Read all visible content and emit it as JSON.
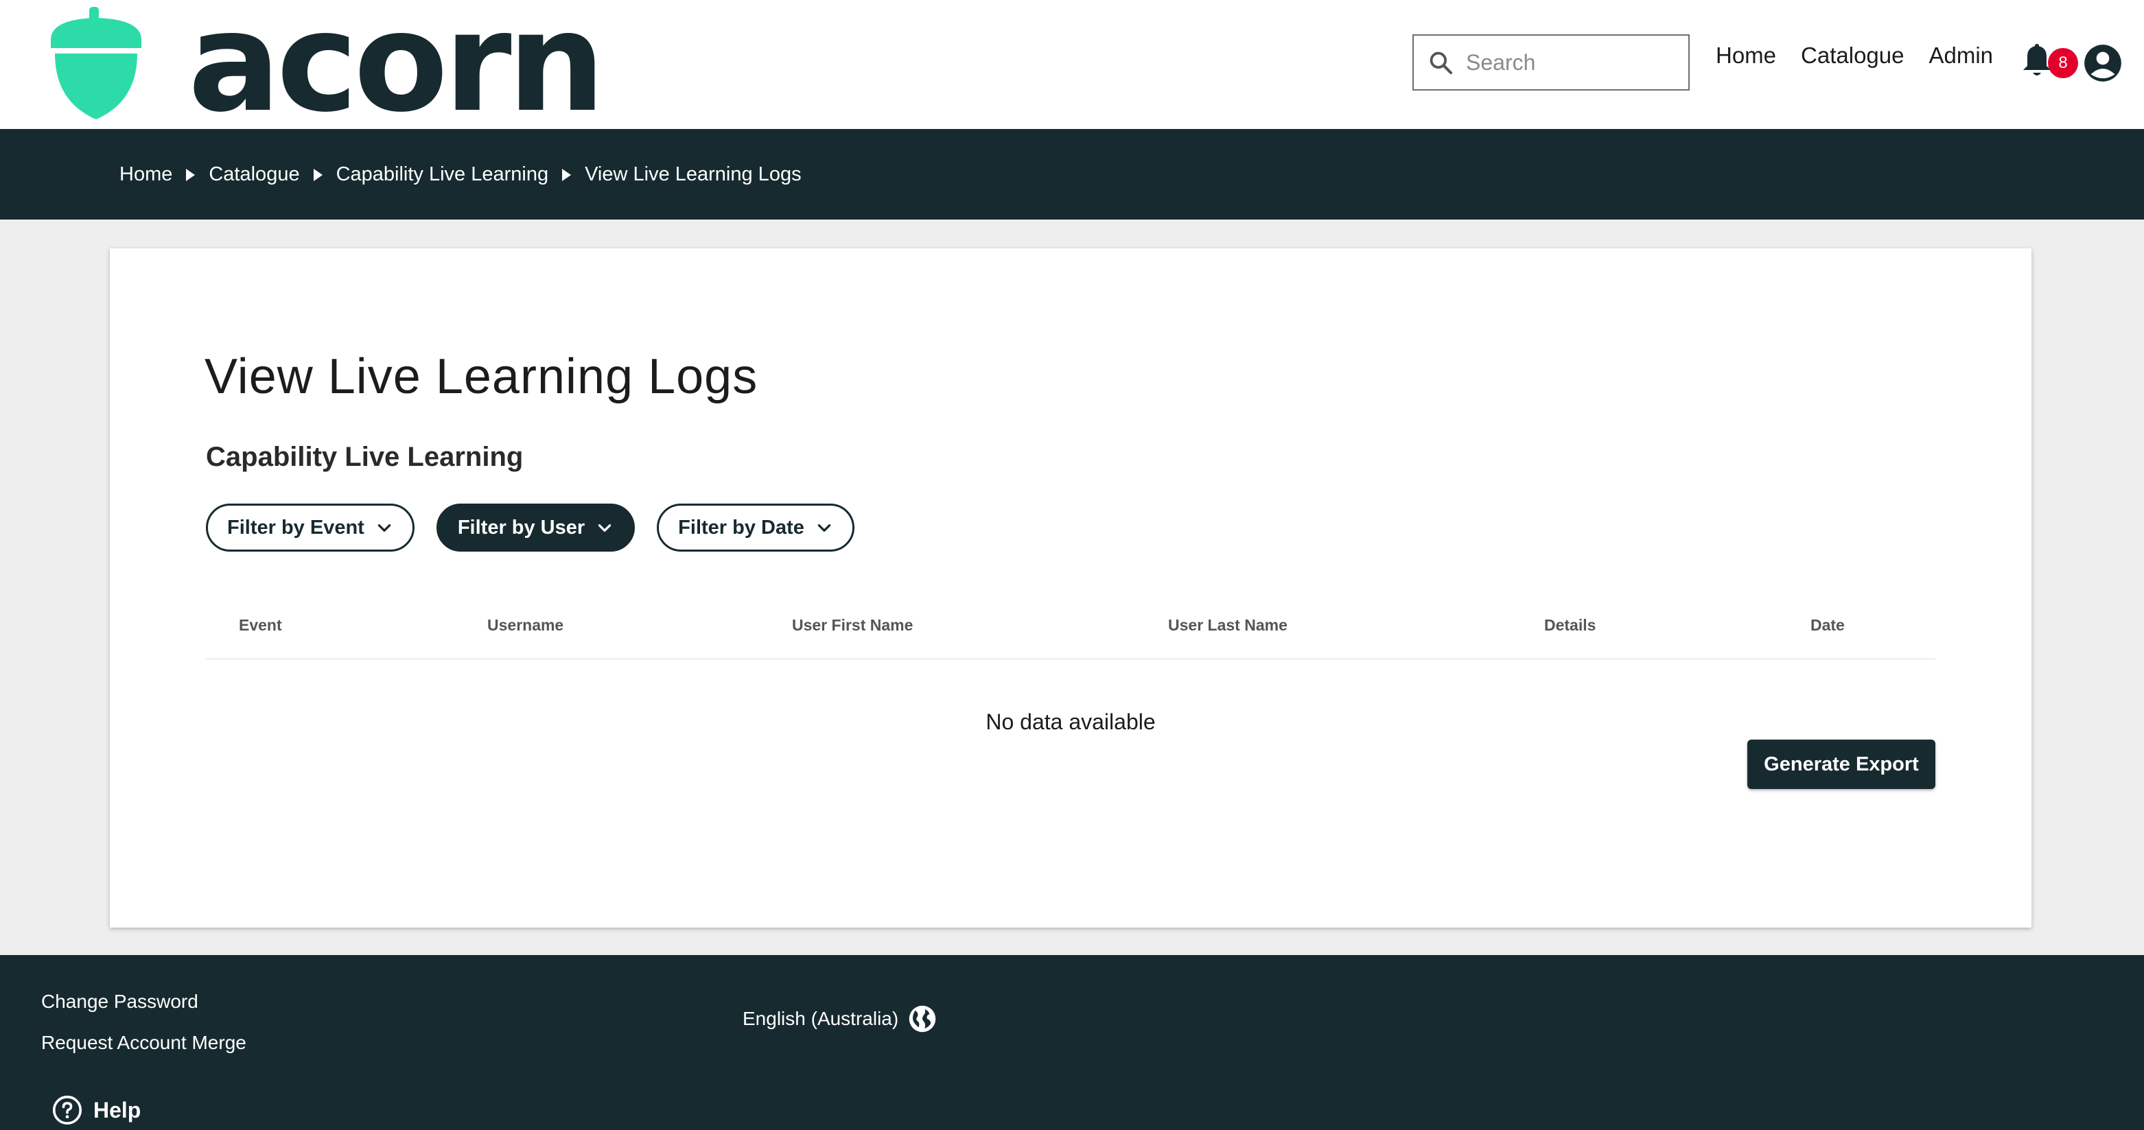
{
  "brand": {
    "name": "acorn",
    "color": "#2ddba8",
    "dark": "#172a30"
  },
  "search": {
    "placeholder": "Search"
  },
  "topnav": {
    "items": [
      "Home",
      "Catalogue",
      "Admin"
    ]
  },
  "notifications": {
    "count": "8"
  },
  "breadcrumb": [
    "Home",
    "Catalogue",
    "Capability Live Learning",
    "View Live Learning Logs"
  ],
  "main": {
    "title": "View Live Learning Logs",
    "subtitle": "Capability Live Learning",
    "filters": [
      "Filter by Event",
      "Filter by User",
      "Filter by Date"
    ],
    "table": {
      "columns": [
        "Event",
        "Username",
        "User First Name",
        "User Last Name",
        "Details",
        "Date"
      ],
      "empty_text": "No data available"
    },
    "export_label": "Generate Export"
  },
  "footer": {
    "links": [
      "Change Password",
      "Request Account Merge"
    ],
    "language": "English (Australia)",
    "help": "Help"
  },
  "icons": [
    "acorn-logo-icon",
    "search-icon",
    "bell-icon",
    "account-icon",
    "chevron-down-icon",
    "globe-icon",
    "help-icon"
  ]
}
